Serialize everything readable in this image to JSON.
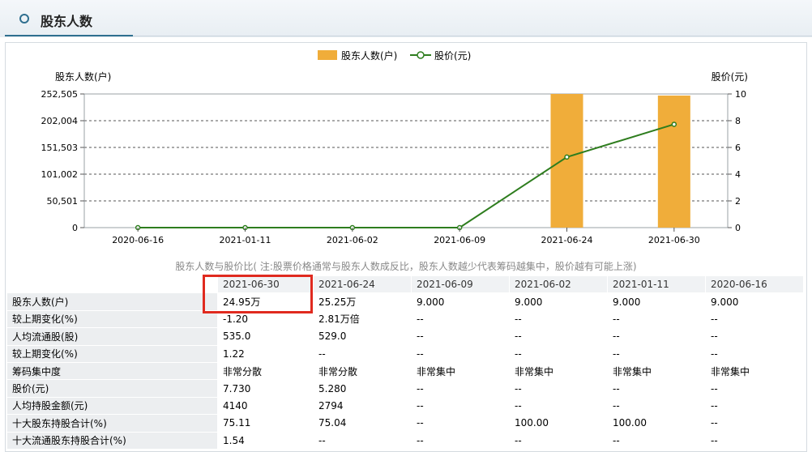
{
  "header": {
    "title": "股东人数"
  },
  "chart_data": {
    "type": "bar",
    "categories": [
      "2020-06-16",
      "2021-01-11",
      "2021-06-02",
      "2021-06-09",
      "2021-06-24",
      "2021-06-30"
    ],
    "series": [
      {
        "name": "股东人数(户)",
        "type": "bar",
        "axis": "left",
        "values": [
          9,
          9,
          9,
          9,
          252500,
          249500
        ]
      },
      {
        "name": "股价(元)",
        "type": "line",
        "axis": "right",
        "values": [
          0,
          0,
          0,
          0,
          5.28,
          7.73
        ]
      }
    ],
    "y_left": {
      "label": "股东人数(户)",
      "ticks": [
        "0",
        "50,501",
        "101,002",
        "151,503",
        "202,004",
        "252,505"
      ],
      "range": [
        0,
        252505
      ]
    },
    "y_right": {
      "label": "股价(元)",
      "ticks": [
        "0",
        "2",
        "4",
        "6",
        "8",
        "10"
      ],
      "range": [
        0,
        10
      ]
    },
    "grid": true,
    "legend": "top-center",
    "colors": {
      "bar": "#f0ad3a",
      "line": "#2e7d1e"
    }
  },
  "note": "股东人数与股价比( 注:股票价格通常与股东人数成反比，股东人数越少代表筹码越集中，股价越有可能上涨)",
  "table": {
    "columns": [
      "2021-06-30",
      "2021-06-24",
      "2021-06-09",
      "2021-06-02",
      "2021-01-11",
      "2020-06-16"
    ],
    "rows": [
      {
        "label": "股东人数(户)",
        "values": [
          "24.95万",
          "25.25万",
          "9.000",
          "9.000",
          "9.000",
          "9.000"
        ]
      },
      {
        "label": "较上期变化(%)",
        "values": [
          "-1.20",
          "2.81万倍",
          "--",
          "--",
          "--",
          "--"
        ]
      },
      {
        "label": "人均流通股(股)",
        "values": [
          "535.0",
          "529.0",
          "--",
          "--",
          "--",
          "--"
        ]
      },
      {
        "label": "较上期变化(%)",
        "values": [
          "1.22",
          "--",
          "--",
          "--",
          "--",
          "--"
        ]
      },
      {
        "label": "筹码集中度",
        "values": [
          "非常分散",
          "非常分散",
          "非常集中",
          "非常集中",
          "非常集中",
          "非常集中"
        ]
      },
      {
        "label": "股价(元)",
        "values": [
          "7.730",
          "5.280",
          "--",
          "--",
          "--",
          "--"
        ]
      },
      {
        "label": "人均持股金额(元)",
        "values": [
          "4140",
          "2794",
          "--",
          "--",
          "--",
          "--"
        ]
      },
      {
        "label": "十大股东持股合计(%)",
        "values": [
          "75.11",
          "75.04",
          "--",
          "100.00",
          "100.00",
          "--"
        ]
      },
      {
        "label": "十大流通股东持股合计(%)",
        "values": [
          "1.54",
          "--",
          "--",
          "--",
          "--",
          "--"
        ]
      }
    ]
  }
}
